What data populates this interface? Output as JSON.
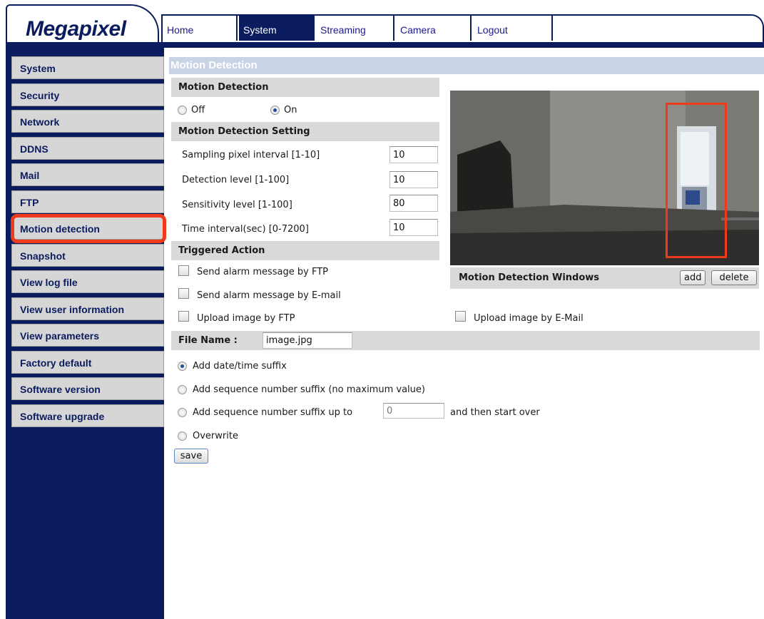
{
  "brand": {
    "logo": "Megapixel"
  },
  "nav": {
    "tabs": [
      {
        "label": "Home"
      },
      {
        "label": "System"
      },
      {
        "label": "Streaming"
      },
      {
        "label": "Camera"
      },
      {
        "label": "Logout"
      }
    ],
    "active": "System"
  },
  "sidebar": {
    "items": [
      {
        "label": "System"
      },
      {
        "label": "Security"
      },
      {
        "label": "Network"
      },
      {
        "label": "DDNS"
      },
      {
        "label": "Mail"
      },
      {
        "label": "FTP"
      },
      {
        "label": "Motion detection"
      },
      {
        "label": "Snapshot"
      },
      {
        "label": "View log file"
      },
      {
        "label": "View user information"
      },
      {
        "label": "View parameters"
      },
      {
        "label": "Factory default"
      },
      {
        "label": "Software version"
      },
      {
        "label": "Software upgrade"
      }
    ],
    "selected": "Motion detection"
  },
  "page": {
    "title": "Motion Detection"
  },
  "motion_detection": {
    "heading": "Motion Detection",
    "off_label": "Off",
    "on_label": "On",
    "selected": "On"
  },
  "settings": {
    "heading": "Motion Detection Setting",
    "fields": [
      {
        "label": "Sampling pixel interval [1-10]",
        "value": "10"
      },
      {
        "label": "Detection level [1-100]",
        "value": "10"
      },
      {
        "label": "Sensitivity level [1-100]",
        "value": "80"
      },
      {
        "label": "Time interval(sec) [0-7200]",
        "value": "10"
      }
    ]
  },
  "preview": {
    "windows_label": "Motion Detection Windows",
    "add_label": "add",
    "delete_label": "delete"
  },
  "triggered": {
    "heading": "Triggered Action",
    "options": [
      {
        "label": "Send alarm message by FTP",
        "checked": false
      },
      {
        "label": "Send alarm message by E-mail",
        "checked": false
      },
      {
        "label": "Upload image by FTP",
        "checked": false
      },
      {
        "label": "Upload image by E-Mail",
        "checked": false
      }
    ]
  },
  "file": {
    "label": "File Name :",
    "value": "image.jpg",
    "suffix_options": [
      {
        "label": "Add date/time suffix"
      },
      {
        "label": "Add sequence number suffix (no maximum value)"
      },
      {
        "label": "Add sequence number suffix up to"
      },
      {
        "label": "Overwrite"
      }
    ],
    "selected_suffix": "Add date/time suffix",
    "sequence_limit_placeholder": "0",
    "start_over_label": "and then start over"
  },
  "save_label": "save",
  "colors": {
    "navy": "#0a1c5e",
    "highlight": "#ef3b1c",
    "section_gray": "#d9d9d9",
    "title_band": "#c8d4e6"
  }
}
